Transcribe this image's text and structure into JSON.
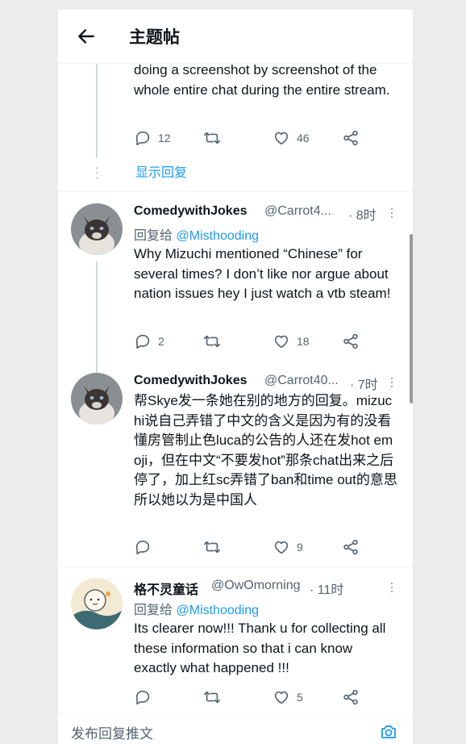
{
  "header": {
    "title": "主题帖"
  },
  "show_replies": "显示回复",
  "tweets": [
    {
      "body": "doing a screenshot by screenshot of the whole entire chat during the entire stream.",
      "reply_count": "12",
      "retweet_count": "",
      "like_count": "46"
    },
    {
      "name": "ComedywithJokes",
      "handle": "@Carrot4...",
      "time": "· 8时",
      "reply_label": "回复给",
      "reply_mention": "@Misthooding",
      "body": "Why Mizuchi mentioned “Chinese” for several times? I don’t like nor argue about nation issues hey I just watch a vtb steam!",
      "reply_count": "2",
      "retweet_count": "",
      "like_count": "18"
    },
    {
      "name": "ComedywithJokes",
      "handle": "@Carrot40...",
      "time": "· 7时",
      "body": "帮Skye发一条她在别的地方的回复。mizuchi说自己弄错了中文的含义是因为有的没看懂房管制止色luca的公告的人还在发hot emoji，但在中文“不要发hot”那条chat出来之后停了，加上红sc弄错了ban和time out的意思所以她以为是中国人",
      "reply_count": "",
      "retweet_count": "",
      "like_count": "9"
    },
    {
      "name": "格不灵童话",
      "handle": "@OwOmorning",
      "time": "· 11时",
      "reply_label": "回复给",
      "reply_mention": "@Misthooding",
      "body": "Its clearer now!!! Thank u for collecting all these information so that i can know exactly what happened !!!",
      "reply_count": "",
      "retweet_count": "",
      "like_count": "5"
    }
  ],
  "composer": {
    "placeholder": "发布回复推文"
  },
  "icons": {
    "back": "arrow-left-icon",
    "reply": "speech-bubble-icon",
    "retweet": "retweet-icon",
    "like": "heart-icon",
    "share": "share-icon",
    "more": "more-vertical-icon",
    "camera": "camera-icon"
  },
  "colors": {
    "accent": "#1d9bf0",
    "muted": "#536471"
  }
}
